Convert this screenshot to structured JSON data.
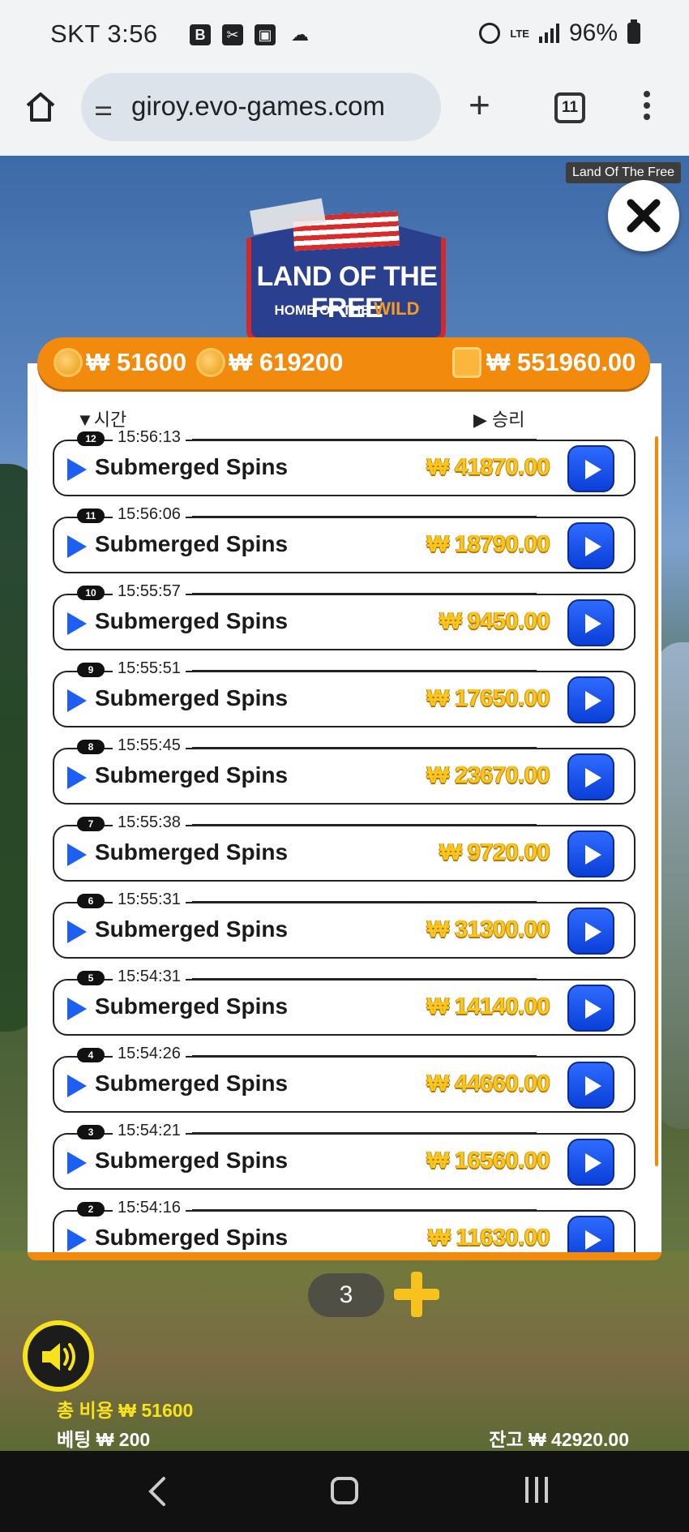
{
  "status_bar": {
    "carrier_time": "SKT 3:56",
    "network": "LTE",
    "battery": "96%"
  },
  "browser": {
    "url": "giroy.evo-games.com",
    "tab_count": "11"
  },
  "game": {
    "title_badge": "Land Of The Free",
    "logo_line1": "LAND OF THE FREE",
    "logo_line2_prefix": "HOME OF THE",
    "logo_line2_highlight": "WILD",
    "stats": {
      "total_cost": "₩ 51600",
      "total_win": "₩ 619200",
      "net": "₩ 551960.00"
    },
    "history": {
      "col_time": "시간",
      "col_win": "승리",
      "rows": [
        {
          "num": "12",
          "time": "15:56:13",
          "title": "Submerged Spins",
          "amount": "₩ 41870.00"
        },
        {
          "num": "11",
          "time": "15:56:06",
          "title": "Submerged Spins",
          "amount": "₩ 18790.00"
        },
        {
          "num": "10",
          "time": "15:55:57",
          "title": "Submerged Spins",
          "amount": "₩ 9450.00"
        },
        {
          "num": "9",
          "time": "15:55:51",
          "title": "Submerged Spins",
          "amount": "₩ 17650.00"
        },
        {
          "num": "8",
          "time": "15:55:45",
          "title": "Submerged Spins",
          "amount": "₩ 23670.00"
        },
        {
          "num": "7",
          "time": "15:55:38",
          "title": "Submerged Spins",
          "amount": "₩ 9720.00"
        },
        {
          "num": "6",
          "time": "15:55:31",
          "title": "Submerged Spins",
          "amount": "₩ 31300.00"
        },
        {
          "num": "5",
          "time": "15:54:31",
          "title": "Submerged Spins",
          "amount": "₩ 14140.00"
        },
        {
          "num": "4",
          "time": "15:54:26",
          "title": "Submerged Spins",
          "amount": "₩ 44660.00"
        },
        {
          "num": "3",
          "time": "15:54:21",
          "title": "Submerged Spins",
          "amount": "₩ 16560.00"
        },
        {
          "num": "2",
          "time": "15:54:16",
          "title": "Submerged Spins",
          "amount": "₩ 11630.00"
        }
      ]
    },
    "spin_count": "3",
    "total_cost_label": "총 비용  ₩ 51600",
    "bet_label": "베팅  ₩ 200",
    "balance_label": "잔고  ₩ 42920.00"
  },
  "icons": {
    "home": "home-icon",
    "tune": "tune-icon",
    "plus": "plus-icon",
    "menu": "more-vert-icon",
    "close": "close-icon",
    "sound": "speaker-icon",
    "replay": "play-icon"
  },
  "colors": {
    "accent_orange": "#f28a0d",
    "amount_gold": "#f8c61c",
    "replay_blue": "#1d5ef5"
  }
}
